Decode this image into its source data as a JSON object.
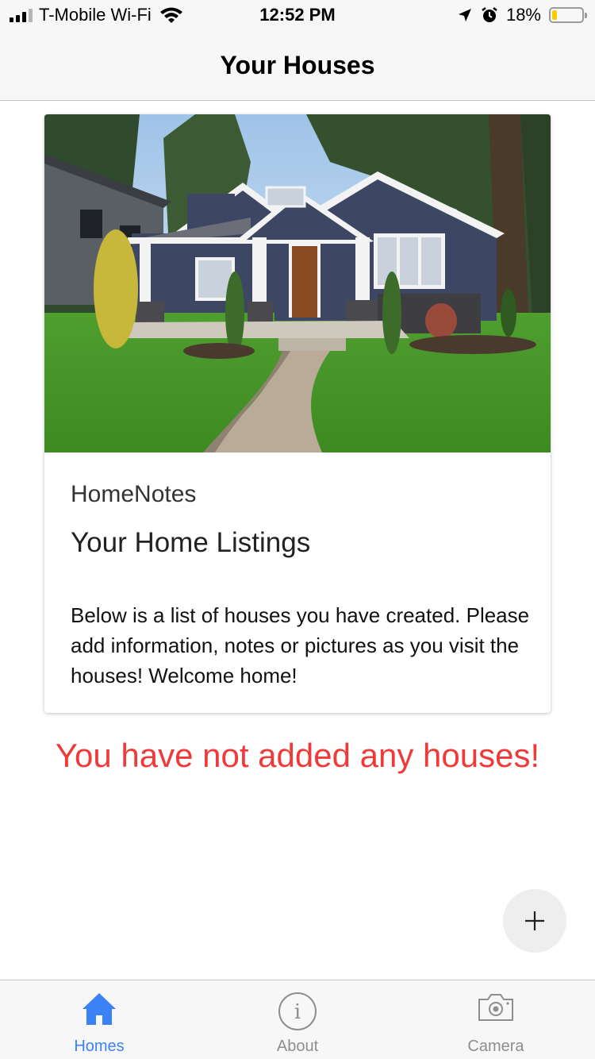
{
  "status_bar": {
    "carrier": "T-Mobile Wi-Fi",
    "time": "12:52 PM",
    "battery_percent": "18%",
    "battery_level": 0.18,
    "battery_color": "#ffcc00",
    "icons": [
      "signal-icon",
      "wifi-icon",
      "location-arrow-icon",
      "alarm-icon",
      "battery-icon"
    ]
  },
  "nav": {
    "title": "Your Houses"
  },
  "card": {
    "image_icon": "house-photo",
    "subtitle": "HomeNotes",
    "title": "Your Home Listings",
    "body": "Below is a list of houses you have created. Please add information, notes or pictures as you visit the houses! Welcome home!"
  },
  "empty_message": {
    "text": "You have not added any houses!",
    "color": "#f03a3a"
  },
  "fab": {
    "icon": "plus-icon"
  },
  "tab_bar": {
    "active_color": "#3b82f6",
    "inactive_color": "#8e8e8e",
    "tabs": [
      {
        "label": "Homes",
        "icon": "home-icon",
        "active": true
      },
      {
        "label": "About",
        "icon": "info-icon",
        "active": false
      },
      {
        "label": "Camera",
        "icon": "camera-icon",
        "active": false
      }
    ]
  }
}
